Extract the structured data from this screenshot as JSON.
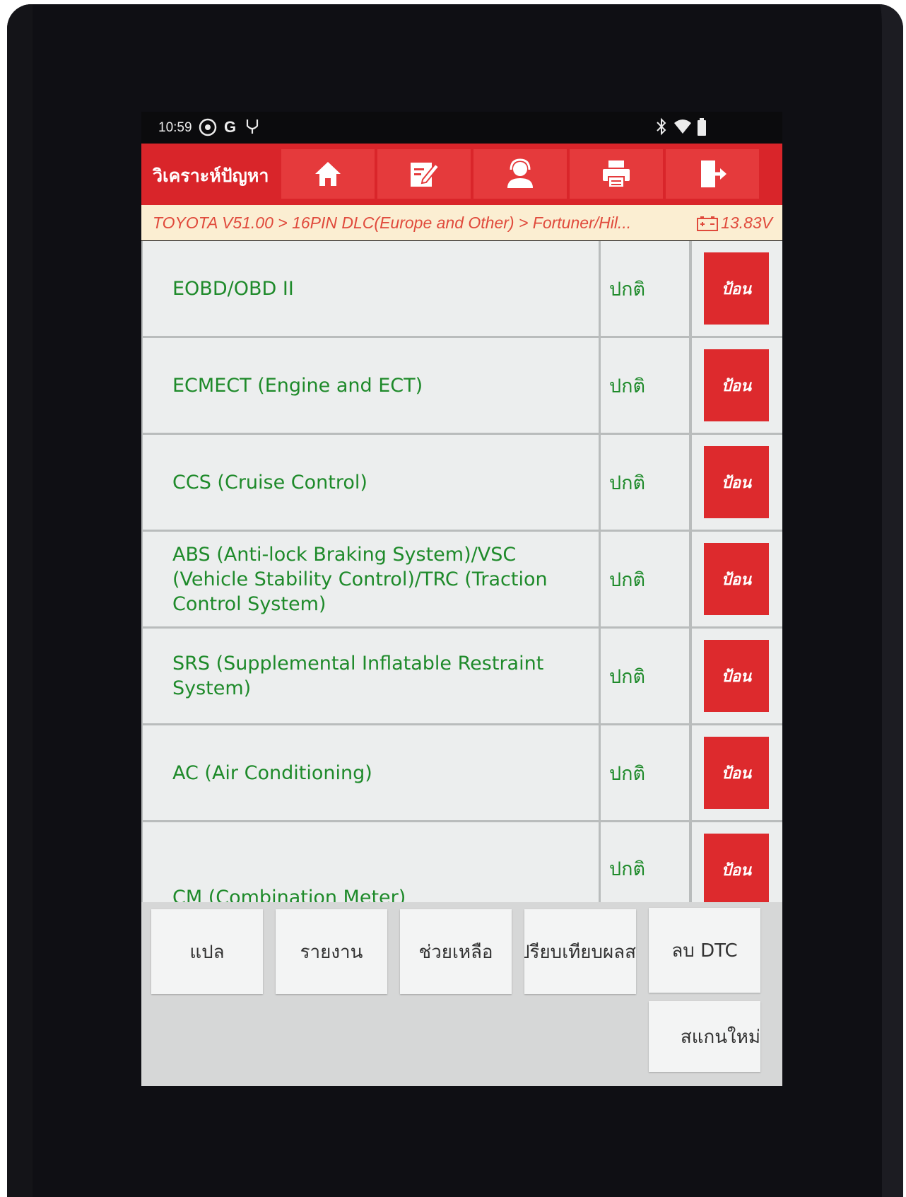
{
  "status_bar": {
    "time": "10:59"
  },
  "toolbar": {
    "title": "วิเคราะห์ปัญหา",
    "accent_color": "#d9252a",
    "icons": [
      "home-icon",
      "edit-icon",
      "support-agent-icon",
      "print-icon",
      "exit-icon"
    ]
  },
  "breadcrumb": {
    "path": "TOYOTA V51.00 > 16PIN DLC(Europe and Other) > Fortuner/Hil...",
    "voltage": "13.83V"
  },
  "systems": [
    {
      "name": "EOBD/OBD II",
      "status": "ปกติ",
      "action": "ป้อน"
    },
    {
      "name": "ECMECT (Engine and ECT)",
      "status": "ปกติ",
      "action": "ป้อน"
    },
    {
      "name": "CCS (Cruise Control)",
      "status": "ปกติ",
      "action": "ป้อน"
    },
    {
      "name": "ABS (Anti-lock Braking System)/VSC (Vehicle Stability Control)/TRC (Traction Control System)",
      "status": "ปกติ",
      "action": "ป้อน"
    },
    {
      "name": "SRS (Supplemental Inflatable Restraint System)",
      "status": "ปกติ",
      "action": "ป้อน"
    },
    {
      "name": "AC (Air Conditioning)",
      "status": "ปกติ",
      "action": "ป้อน"
    },
    {
      "name": "CM (Combination Meter)",
      "status": "ปกติ",
      "action": "ป้อน"
    }
  ],
  "footer": {
    "translate": "แปล",
    "report": "รายงาน",
    "help": "ช่วยเหลือ",
    "compare": "เปรียบเทียบผลส",
    "clear_dtc": "ลบ DTC",
    "rescan": "สแกนใหม่"
  }
}
